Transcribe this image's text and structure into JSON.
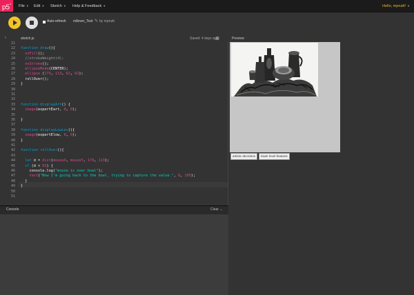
{
  "nav": {
    "logo": "p5",
    "logo_sup": "*",
    "menu": [
      {
        "label": "File"
      },
      {
        "label": "Edit"
      },
      {
        "label": "Sketch"
      },
      {
        "label": "Help & Feedback"
      }
    ],
    "greeting": "Hello, mpruitt!"
  },
  "toolbar": {
    "auto_refresh_label": "Auto-refresh",
    "sketch_name": "rollover_Test",
    "by_user": "by mpruitt"
  },
  "editor": {
    "file_tab": "sketch.js",
    "saved_status": "Saved: 4 days ago",
    "lines": [
      {
        "n": "21",
        "tokens": []
      },
      {
        "n": "22",
        "tokens": [
          {
            "t": "function ",
            "c": "kw"
          },
          {
            "t": "draw",
            "c": "fn"
          },
          {
            "t": "(){",
            "c": "pc"
          }
        ]
      },
      {
        "n": "23",
        "tokens": [
          {
            "t": "  noFill",
            "c": "pf"
          },
          {
            "t": "();",
            "c": "pc"
          }
        ]
      },
      {
        "n": "24",
        "tokens": [
          {
            "t": "  //strokeWeight(4);",
            "c": "cm"
          }
        ]
      },
      {
        "n": "25",
        "tokens": [
          {
            "t": "  noStroke",
            "c": "pf"
          },
          {
            "t": "();",
            "c": "pc"
          }
        ]
      },
      {
        "n": "26",
        "tokens": [
          {
            "t": "  ellipseMode",
            "c": "pf"
          },
          {
            "t": "(CENTER);",
            "c": "pc"
          }
        ]
      },
      {
        "n": "27",
        "tokens": [
          {
            "t": "  ellipse ",
            "c": "pf"
          },
          {
            "t": "(",
            "c": "pc"
          },
          {
            "t": "179",
            "c": "nm"
          },
          {
            "t": ", ",
            "c": "pc"
          },
          {
            "t": "113",
            "c": "nm"
          },
          {
            "t": ", ",
            "c": "pc"
          },
          {
            "t": "62",
            "c": "nm"
          },
          {
            "t": ", ",
            "c": "pc"
          },
          {
            "t": "62",
            "c": "nm"
          },
          {
            "t": ");",
            "c": "pc"
          }
        ]
      },
      {
        "n": "28",
        "tokens": [
          {
            "t": "  rollOver",
            "c": "pl"
          },
          {
            "t": "();",
            "c": "pc"
          }
        ]
      },
      {
        "n": "29",
        "tokens": [
          {
            "t": "}",
            "c": "pc"
          }
        ]
      },
      {
        "n": "30",
        "tokens": []
      },
      {
        "n": "31",
        "tokens": []
      },
      {
        "n": "32",
        "tokens": []
      },
      {
        "n": "33",
        "tokens": [
          {
            "t": "function ",
            "c": "kw"
          },
          {
            "t": "displayArt",
            "c": "fn"
          },
          {
            "t": "() {",
            "c": "pc"
          }
        ]
      },
      {
        "n": "34",
        "tokens": [
          {
            "t": "  image",
            "c": "pf"
          },
          {
            "t": "(expertEart, ",
            "c": "pc"
          },
          {
            "t": "0",
            "c": "nm"
          },
          {
            "t": ", ",
            "c": "pc"
          },
          {
            "t": "0",
            "c": "nm"
          },
          {
            "t": ");",
            "c": "pc"
          }
        ]
      },
      {
        "n": "35",
        "tokens": []
      },
      {
        "n": "36",
        "tokens": [
          {
            "t": "}",
            "c": "pc"
          }
        ]
      },
      {
        "n": "37",
        "tokens": []
      },
      {
        "n": "38",
        "tokens": [
          {
            "t": "function ",
            "c": "kw"
          },
          {
            "t": "displayLowLev",
            "c": "fn"
          },
          {
            "t": "(){",
            "c": "pc"
          }
        ]
      },
      {
        "n": "39",
        "tokens": [
          {
            "t": "  image",
            "c": "pf"
          },
          {
            "t": "(expertElow, ",
            "c": "pc"
          },
          {
            "t": "0",
            "c": "nm"
          },
          {
            "t": ", ",
            "c": "pc"
          },
          {
            "t": "0",
            "c": "nm"
          },
          {
            "t": ");",
            "c": "pc"
          }
        ]
      },
      {
        "n": "40",
        "tokens": [
          {
            "t": "}",
            "c": "pc"
          }
        ]
      },
      {
        "n": "41",
        "tokens": []
      },
      {
        "n": "42",
        "tokens": [
          {
            "t": "function ",
            "c": "kw"
          },
          {
            "t": "rollOver",
            "c": "fn"
          },
          {
            "t": "(){",
            "c": "pc"
          }
        ]
      },
      {
        "n": "43",
        "tokens": []
      },
      {
        "n": "44",
        "tokens": [
          {
            "t": "  let ",
            "c": "kw"
          },
          {
            "t": "d ",
            "c": "pc"
          },
          {
            "t": "= ",
            "c": "pc"
          },
          {
            "t": "dist",
            "c": "pf"
          },
          {
            "t": "(",
            "c": "pc"
          },
          {
            "t": "mouseX",
            "c": "pf"
          },
          {
            "t": ", ",
            "c": "pc"
          },
          {
            "t": "mouseY",
            "c": "pf"
          },
          {
            "t": ", ",
            "c": "pc"
          },
          {
            "t": "179",
            "c": "nm"
          },
          {
            "t": ", ",
            "c": "pc"
          },
          {
            "t": "113",
            "c": "nm"
          },
          {
            "t": ");",
            "c": "pc"
          }
        ]
      },
      {
        "n": "45",
        "tokens": [
          {
            "t": "  if ",
            "c": "kw"
          },
          {
            "t": "(d < ",
            "c": "pc"
          },
          {
            "t": "62",
            "c": "nm"
          },
          {
            "t": ") {",
            "c": "pc"
          }
        ]
      },
      {
        "n": "46",
        "tokens": [
          {
            "t": "    console",
            "c": "pc"
          },
          {
            "t": ".log(",
            "c": "pc"
          },
          {
            "t": "\"mouse is over bowl\"",
            "c": "st"
          },
          {
            "t": ");",
            "c": "pc"
          }
        ]
      },
      {
        "n": "47",
        "tokens": [
          {
            "t": "    text",
            "c": "pf"
          },
          {
            "t": "(",
            "c": "pc"
          },
          {
            "t": "\"Now I'm going back to the bowl, trying to capture the value.\"",
            "c": "st"
          },
          {
            "t": ", ",
            "c": "pc"
          },
          {
            "t": "0",
            "c": "nm"
          },
          {
            "t": ", ",
            "c": "pc"
          },
          {
            "t": "195",
            "c": "nm"
          },
          {
            "t": ");",
            "c": "pc"
          }
        ]
      },
      {
        "n": "48",
        "tokens": [
          {
            "t": "  }",
            "c": "pc"
          }
        ]
      },
      {
        "n": "49",
        "tokens": [
          {
            "t": "}",
            "c": "pc"
          }
        ]
      },
      {
        "n": "50",
        "tokens": []
      },
      {
        "n": "51",
        "tokens": []
      }
    ]
  },
  "preview": {
    "label": "Preview",
    "buttons": [
      {
        "label": "artistic decisions"
      },
      {
        "label": "lower level features"
      }
    ]
  },
  "console": {
    "label": "Console",
    "clear_label": "Clear"
  }
}
